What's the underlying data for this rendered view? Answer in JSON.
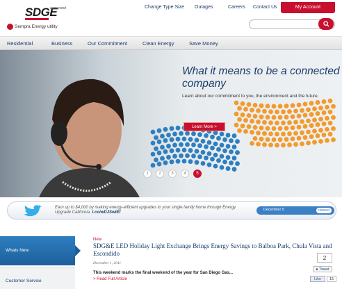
{
  "header": {
    "logo_text": "SDGE",
    "logo_connected": "connected",
    "parent_company": "Sempra Energy utility",
    "top_links": [
      "Change Type Size",
      "Outages",
      "Careers",
      "Contact Us"
    ],
    "account_button": "My Account",
    "search_placeholder": ""
  },
  "main_nav": [
    "Residential",
    "Business",
    "Our Commitment",
    "Clean Energy",
    "Save Money"
  ],
  "hero": {
    "headline": "What it means to be a connected company",
    "subtext": "Learn about our commitment to you, the environment and the future.",
    "cta": "Learn More  >",
    "pages": [
      "1",
      "2",
      "3",
      "4",
      "5"
    ],
    "active_page": "5"
  },
  "twitter": {
    "text": "Earn up to $4,000 by making energy-efficient upgrades to your single family home through Energy Upgrade California.",
    "link": "t.co/wDJSwIEf",
    "date": "December 5",
    "retweet": "retweet"
  },
  "sidebar": {
    "tabs": [
      "Whats New",
      "Customer Service"
    ],
    "active": "Whats New"
  },
  "news": {
    "badge": "New",
    "title": "SDG&E LED Holiday Light Exchange Brings Energy Savings to Balboa Park, Chula Vista and Escondido",
    "date": "December 1, 2011",
    "snippet": "This weekend marks the final weekend of the year for San Diego Gas...",
    "read_more": "Read Full Article",
    "share_count": "2",
    "tweet_label": "Tweet",
    "like_label": "Like",
    "like_count": "15"
  },
  "colors": {
    "brand_red": "#c8102e",
    "brand_blue": "#1a3d6b",
    "accent_blue": "#2e7fc0",
    "accent_orange": "#f39a2d"
  }
}
